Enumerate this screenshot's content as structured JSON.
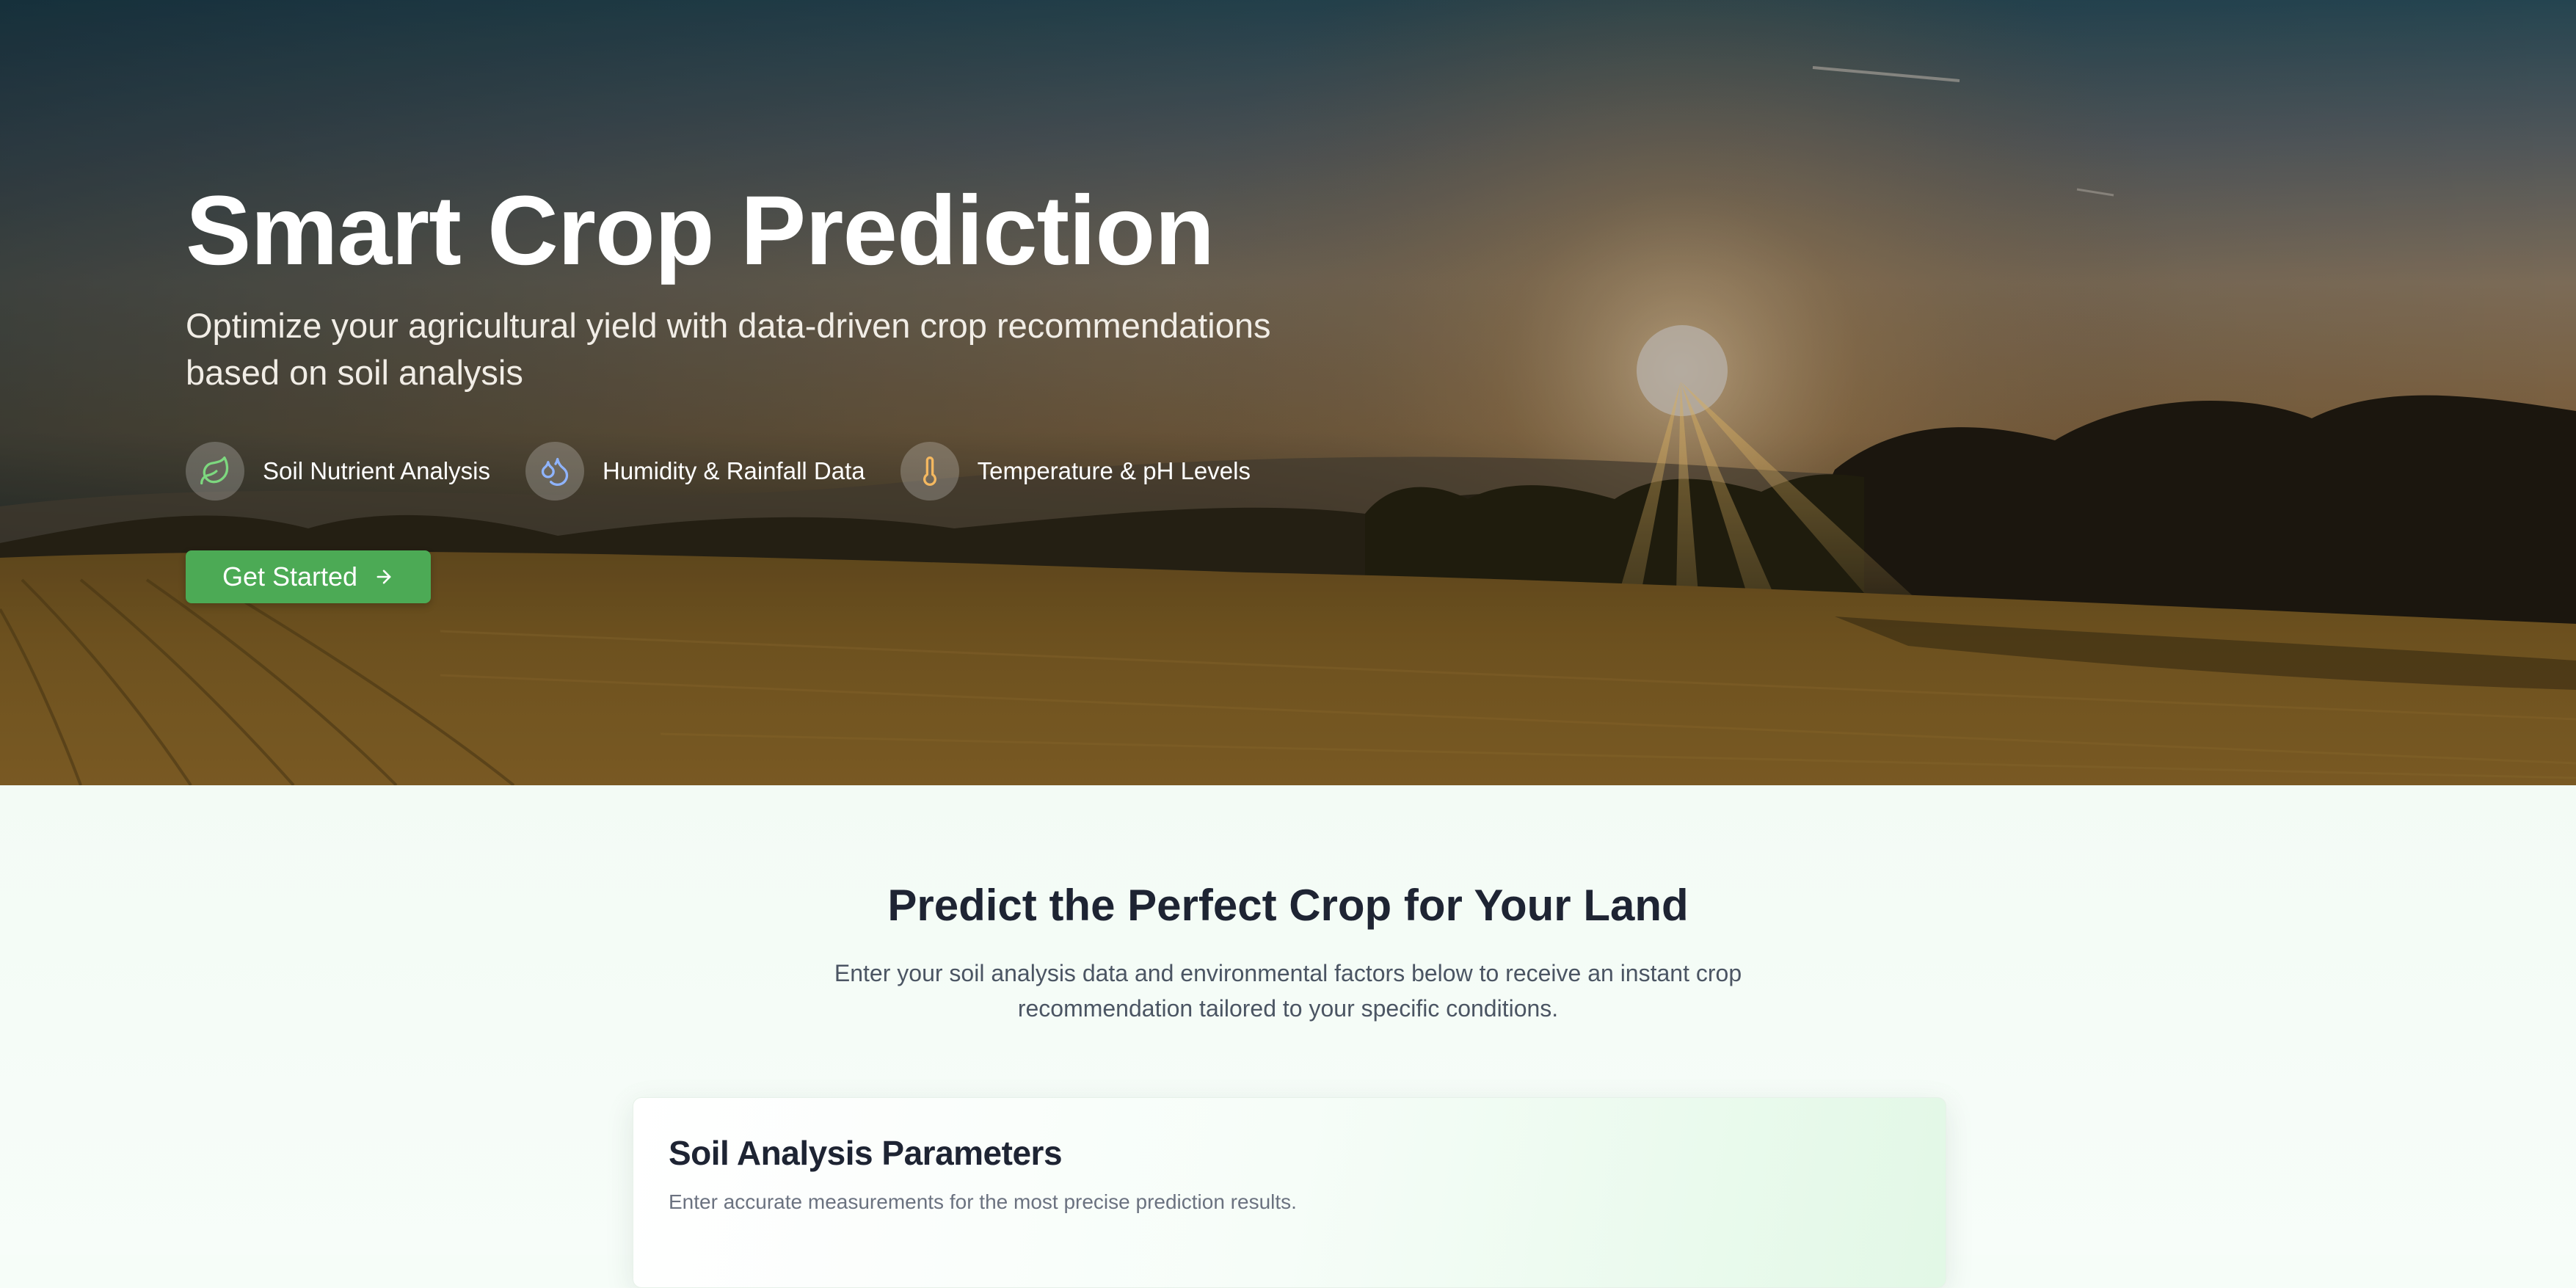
{
  "hero": {
    "title": "Smart Crop Prediction",
    "subtitle": "Optimize your agricultural yield with data-driven crop recommendations based on soil analysis",
    "features": [
      {
        "label": "Soil Nutrient Analysis",
        "icon": "leaf-icon",
        "color": "#7dd87f"
      },
      {
        "label": "Humidity & Rainfall Data",
        "icon": "water-drops-icon",
        "color": "#8fb4ff"
      },
      {
        "label": "Temperature & pH Levels",
        "icon": "thermometer-icon",
        "color": "#f4b860"
      }
    ],
    "cta_label": "Get Started",
    "cta_color": "#4caa55"
  },
  "section": {
    "title": "Predict the Perfect Crop for Your Land",
    "description": "Enter your soil analysis data and environmental factors below to receive an instant crop recommendation tailored to your specific conditions."
  },
  "card": {
    "title": "Soil Analysis Parameters",
    "description": "Enter accurate measurements for the most precise prediction results."
  }
}
